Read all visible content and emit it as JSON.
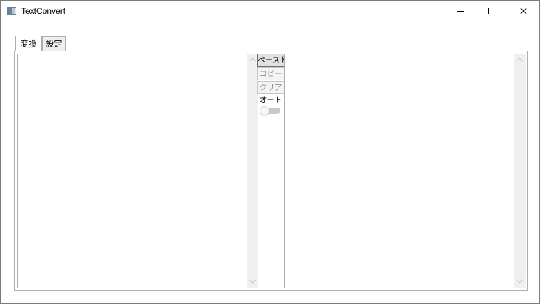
{
  "window": {
    "title": "TextConvert"
  },
  "tabs": [
    {
      "label": "変換",
      "selected": true
    },
    {
      "label": "設定",
      "selected": false
    }
  ],
  "input_box": {
    "value": ""
  },
  "output_box": {
    "value": ""
  },
  "actions": {
    "paste_label": "ペースト",
    "copy_label": "コピー",
    "clear_label": "クリア",
    "copy_enabled": false,
    "clear_enabled": false
  },
  "auto": {
    "label": "オート",
    "on": false
  },
  "icons": {
    "app": "app-window-icon",
    "minimize": "minimize-icon",
    "maximize": "maximize-icon",
    "close": "close-icon",
    "scroll_up": "scroll-up-arrow-icon",
    "scroll_down": "scroll-down-arrow-icon"
  },
  "colors": {
    "border": "#adadad",
    "button_face": "#f0f0f0",
    "disabled_text": "#8d8d8d",
    "toggle_off": "#c9c9c9"
  }
}
